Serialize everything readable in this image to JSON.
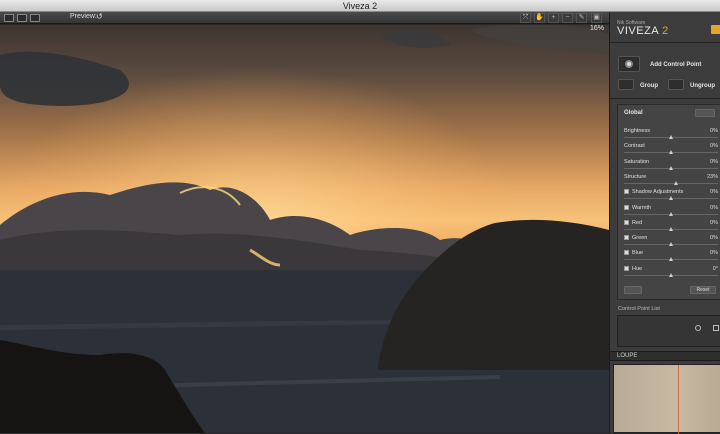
{
  "window": {
    "title": "Viveza 2"
  },
  "toolbar": {
    "preview_label": "Preview:",
    "zoom": "16%"
  },
  "panel": {
    "brand_small": "Nik Software",
    "brand_name": "VIVEZA",
    "brand_version": "2",
    "add_control_point": "Add Control Point",
    "group": "Group",
    "ungroup": "Ungroup",
    "global_title": "Global",
    "sliders": [
      {
        "name": "Brightness",
        "value": "0%",
        "checkbox": false,
        "level": 0
      },
      {
        "name": "Contrast",
        "value": "0%",
        "checkbox": false,
        "level": 0
      },
      {
        "name": "Saturation",
        "value": "0%",
        "checkbox": false,
        "level": 0
      },
      {
        "name": "Structure",
        "value": "23%",
        "checkbox": false,
        "level": 23
      },
      {
        "name": "Shadow Adjustments",
        "value": "0%",
        "checkbox": true,
        "level": 0
      },
      {
        "name": "Warmth",
        "value": "0%",
        "checkbox": true,
        "level": 0
      },
      {
        "name": "Red",
        "value": "0%",
        "checkbox": true,
        "level": 0
      },
      {
        "name": "Green",
        "value": "0%",
        "checkbox": true,
        "level": 0
      },
      {
        "name": "Blue",
        "value": "0%",
        "checkbox": true,
        "level": 0
      },
      {
        "name": "Hue",
        "value": "0°",
        "checkbox": true,
        "level": 0
      }
    ],
    "reset_label": "Reset",
    "control_point_list": "Control Point List",
    "loupe": "LOUPE"
  },
  "colors": {
    "accent": "#e3a52b",
    "panel_bg": "#3c3c3c"
  }
}
